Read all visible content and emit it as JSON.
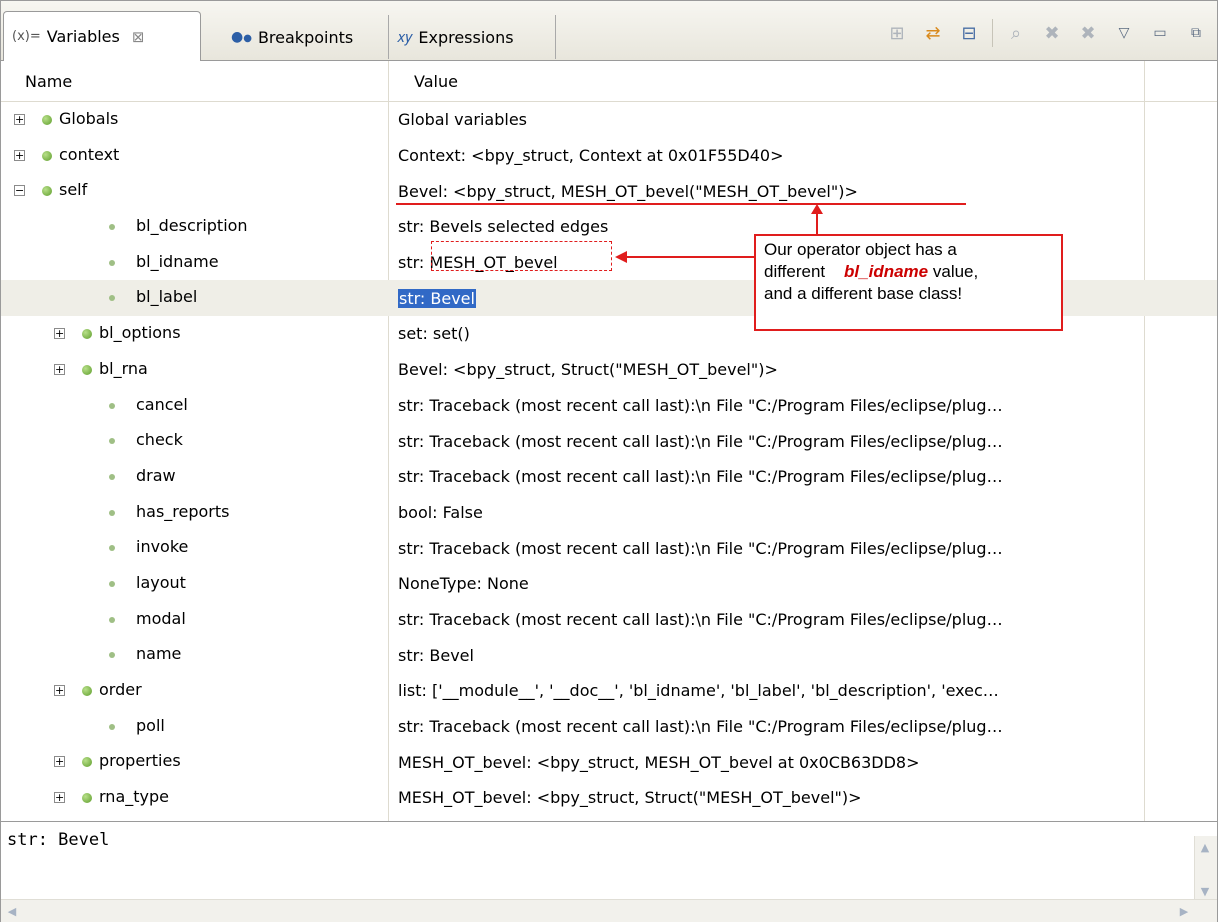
{
  "tabs": [
    {
      "label": "Variables",
      "icon": "variables-icon",
      "active": true
    },
    {
      "label": "Breakpoints",
      "icon": "breakpoints-icon",
      "active": false
    },
    {
      "label": "Expressions",
      "icon": "expressions-icon",
      "active": false
    }
  ],
  "tab_prefix": "(x)=",
  "toolbar_icons": [
    "show-type-names-icon",
    "show-logical-structure-icon",
    "collapse-all-icon",
    "remove-expression-icon",
    "remove-selected-icon",
    "remove-all-icon",
    "view-menu-icon",
    "minimize-icon",
    "maximize-icon"
  ],
  "columns": {
    "name": "Name",
    "value": "Value"
  },
  "rows": [
    {
      "name": "Globals",
      "value": "Global variables",
      "level": 0,
      "expandable": true,
      "expanded": false
    },
    {
      "name": "context",
      "value": "Context: <bpy_struct, Context at 0x01F55D40>",
      "level": 0,
      "expandable": true,
      "expanded": false
    },
    {
      "name": "self",
      "value": "Bevel: <bpy_struct, MESH_OT_bevel(\"MESH_OT_bevel\")>",
      "level": 0,
      "expandable": true,
      "expanded": true
    },
    {
      "name": "bl_description",
      "value": "str: Bevels selected edges",
      "level": 1,
      "expandable": false
    },
    {
      "name": "bl_idname",
      "value": "str: MESH_OT_bevel",
      "level": 1,
      "expandable": false
    },
    {
      "name": "bl_label",
      "value": "str: Bevel",
      "level": 1,
      "expandable": false,
      "selected": true
    },
    {
      "name": "bl_options",
      "value": "set: set()",
      "level": 1,
      "expandable": true,
      "expanded": false
    },
    {
      "name": "bl_rna",
      "value": "Bevel: <bpy_struct, Struct(\"MESH_OT_bevel\")>",
      "level": 1,
      "expandable": true,
      "expanded": false
    },
    {
      "name": "cancel",
      "value": "str: Traceback (most recent call last):\\n  File \"C:/Program Files/eclipse/plug…",
      "level": 1,
      "expandable": false
    },
    {
      "name": "check",
      "value": "str: Traceback (most recent call last):\\n  File \"C:/Program Files/eclipse/plug…",
      "level": 1,
      "expandable": false
    },
    {
      "name": "draw",
      "value": "str: Traceback (most recent call last):\\n  File \"C:/Program Files/eclipse/plug…",
      "level": 1,
      "expandable": false
    },
    {
      "name": "has_reports",
      "value": "bool: False",
      "level": 1,
      "expandable": false
    },
    {
      "name": "invoke",
      "value": "str: Traceback (most recent call last):\\n  File \"C:/Program Files/eclipse/plug…",
      "level": 1,
      "expandable": false
    },
    {
      "name": "layout",
      "value": "NoneType: None",
      "level": 1,
      "expandable": false
    },
    {
      "name": "modal",
      "value": "str: Traceback (most recent call last):\\n  File \"C:/Program Files/eclipse/plug…",
      "level": 1,
      "expandable": false
    },
    {
      "name": "name",
      "value": "str: Bevel",
      "level": 1,
      "expandable": false
    },
    {
      "name": "order",
      "value": "list: ['__module__', '__doc__', 'bl_idname', 'bl_label', 'bl_description', 'exec…",
      "level": 1,
      "expandable": true,
      "expanded": false
    },
    {
      "name": "poll",
      "value": "str: Traceback (most recent call last):\\n  File \"C:/Program Files/eclipse/plug…",
      "level": 1,
      "expandable": false
    },
    {
      "name": "properties",
      "value": "MESH_OT_bevel: <bpy_struct, MESH_OT_bevel at 0x0CB63DD8>",
      "level": 1,
      "expandable": true,
      "expanded": false
    },
    {
      "name": "rna_type",
      "value": "MESH_OT_bevel: <bpy_struct, Struct(\"MESH_OT_bevel\")>",
      "level": 1,
      "expandable": true,
      "expanded": false
    }
  ],
  "detail_text": "str: Bevel",
  "annotation": {
    "line1": "Our operator object has a",
    "line2_pre": "different",
    "line2_em": "bl_idname",
    "line2_post": "value,",
    "line3": "and a different base class!",
    "color": "#e01d1d"
  },
  "colors": {
    "selection": "#3169c6",
    "row_highlight": "#efeee7",
    "annotation": "#e01d1d"
  }
}
